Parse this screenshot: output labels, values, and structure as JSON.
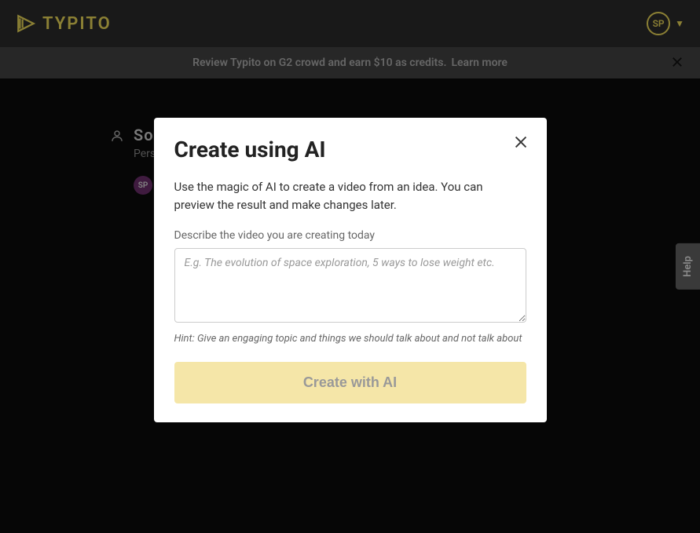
{
  "header": {
    "logo_text": "TYPITO",
    "user_initials": "SP"
  },
  "banner": {
    "text": "Review Typito on G2 crowd and earn $10 as credits.",
    "link": "Learn more"
  },
  "page": {
    "user_name": "Soha",
    "user_subtitle": "Perso",
    "avatar_initials": "SP"
  },
  "help": {
    "label": "Help"
  },
  "modal": {
    "title": "Create using AI",
    "description": "Use the magic of AI to create a video from an idea. You can preview the result and make changes later.",
    "field_label": "Describe the video you are creating today",
    "placeholder": "E.g. The evolution of space exploration, 5 ways to lose weight etc.",
    "hint": "Hint: Give an engaging topic and things we should talk about and not talk about",
    "button": "Create with AI"
  }
}
